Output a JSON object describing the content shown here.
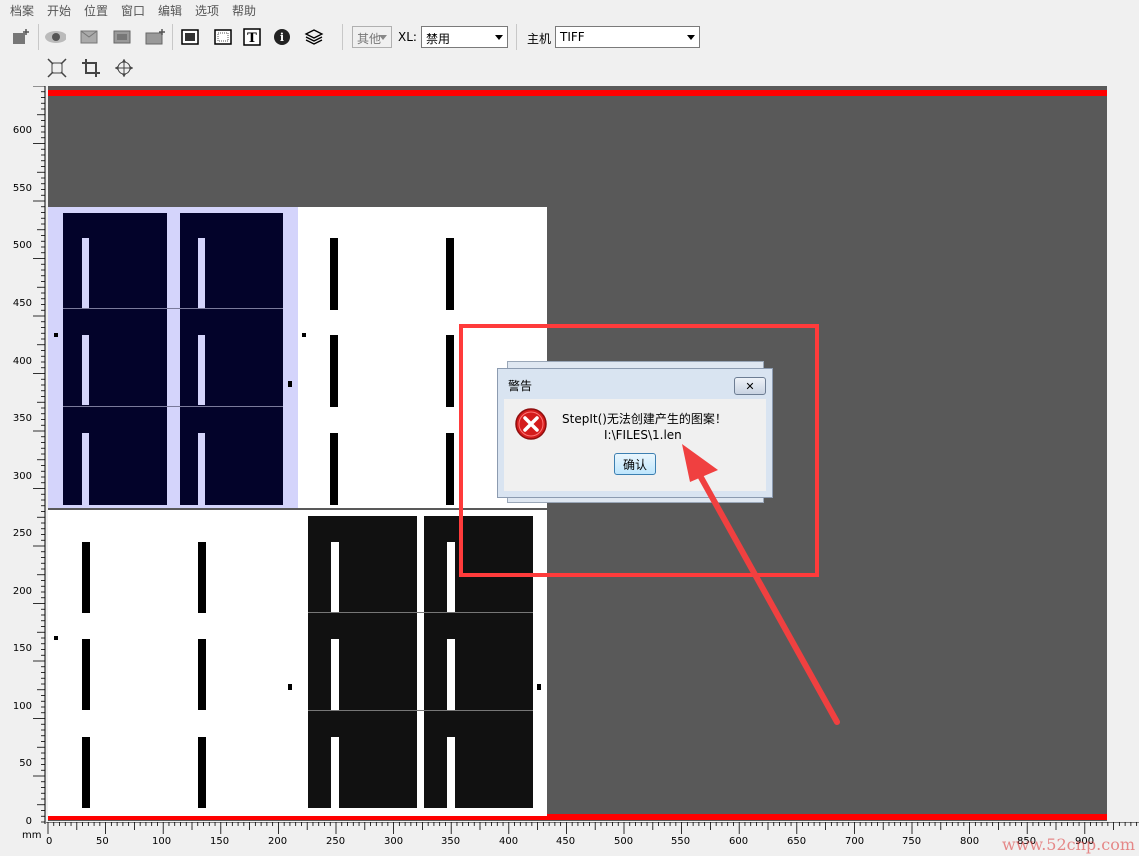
{
  "menubar": {
    "items": [
      "档案",
      "开始",
      "位置",
      "窗口",
      "编辑",
      "选项",
      "帮助"
    ]
  },
  "toolbar": {
    "icons": [
      "new-layer-icon",
      "eye-icon",
      "rectangle-icon",
      "double-rectangle-icon",
      "add-frame-icon",
      "fill-box-icon",
      "dotted-box-icon",
      "text-icon",
      "info-icon",
      "layers-icon",
      "transform-icon",
      "crop-icon",
      "move-icon"
    ],
    "other_combo": "其他",
    "xl_label": "XL:",
    "xl_value": "禁用",
    "host_label": "主机",
    "host_value": "TIFF"
  },
  "ruler_vertical": {
    "labels": [
      "600",
      "550",
      "500",
      "450",
      "400",
      "350",
      "300",
      "250",
      "200",
      "150",
      "100",
      "50",
      "0"
    ]
  },
  "ruler_horizontal": {
    "unit": "mm",
    "labels": [
      "0",
      "50",
      "100",
      "150",
      "200",
      "250",
      "300",
      "350",
      "400",
      "450",
      "500",
      "550",
      "600",
      "650",
      "700",
      "750",
      "800",
      "850",
      "900"
    ]
  },
  "dialog": {
    "title": "警告",
    "close_glyph": "✕",
    "message_line1": "StepIt()无法创建产生的图案！",
    "message_line2": "I:\\FILES\\1.len",
    "ok_label": "确认"
  },
  "colors": {
    "canvas": "#595959",
    "highlight": "#ff3b3b",
    "selected_tile_bg": "#d4d4fb",
    "dark_tile": "#03032a"
  },
  "watermark": "www.52cnp.com"
}
